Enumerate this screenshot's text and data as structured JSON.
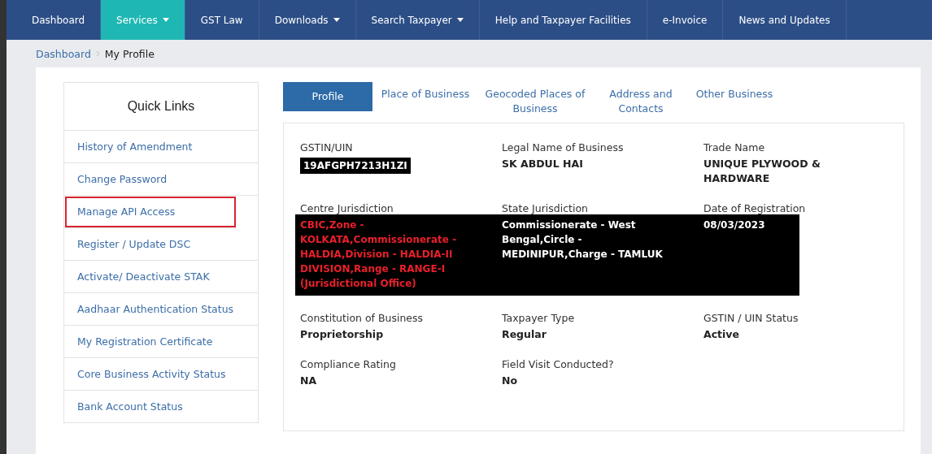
{
  "nav": [
    {
      "label": "Dashboard",
      "selected": false,
      "dropdown": false
    },
    {
      "label": "Services",
      "selected": true,
      "dropdown": true
    },
    {
      "label": "GST Law",
      "selected": false,
      "dropdown": false
    },
    {
      "label": "Downloads",
      "selected": false,
      "dropdown": true
    },
    {
      "label": "Search Taxpayer",
      "selected": false,
      "dropdown": true
    },
    {
      "label": "Help and Taxpayer Facilities",
      "selected": false,
      "dropdown": false
    },
    {
      "label": "e-Invoice",
      "selected": false,
      "dropdown": false
    },
    {
      "label": "News and Updates",
      "selected": false,
      "dropdown": false
    }
  ],
  "breadcrumb": [
    "Dashboard",
    "My Profile"
  ],
  "quick_links": {
    "title": "Quick Links",
    "items": [
      {
        "label": "History of Amendment",
        "highlighted": false
      },
      {
        "label": "Change Password",
        "highlighted": false
      },
      {
        "label": "Manage API Access",
        "highlighted": true
      },
      {
        "label": "Register / Update DSC",
        "highlighted": false
      },
      {
        "label": "Activate/ Deactivate STAK",
        "highlighted": false
      },
      {
        "label": "Aadhaar Authentication Status",
        "highlighted": false
      },
      {
        "label": "My Registration Certificate",
        "highlighted": false
      },
      {
        "label": "Core Business Activity Status",
        "highlighted": false
      },
      {
        "label": "Bank Account Status",
        "highlighted": false
      }
    ]
  },
  "tabs": [
    {
      "label": "Profile",
      "selected": true
    },
    {
      "label": "Place of Business",
      "selected": false
    },
    {
      "label": "Geocoded Places of Business",
      "selected": false
    },
    {
      "label": "Address and Contacts",
      "selected": false
    },
    {
      "label": "Other Business",
      "selected": false
    }
  ],
  "gstin": {
    "label": "GSTIN/UIN",
    "value": "19AFGPH7213H1ZI"
  },
  "rows": [
    [
      {
        "label": "Legal Name of Business",
        "value": "SK ABDUL HAI"
      },
      {
        "label": "Trade Name",
        "value": "UNIQUE PLYWOOD & HARDWARE"
      }
    ],
    [
      {
        "label": "Constitution of Business",
        "value": "Proprietorship"
      },
      {
        "label": "Taxpayer Type",
        "value": "Regular"
      },
      {
        "label": "GSTIN / UIN Status",
        "value": "Active"
      }
    ],
    [
      {
        "label": "Compliance Rating",
        "value": "NA"
      },
      {
        "label": "Field Visit Conducted?",
        "value": "No"
      }
    ]
  ],
  "jurisdiction": [
    {
      "label": "Centre Jurisdiction",
      "value": "CBIC,Zone - KOLKATA,Commissionerate - HALDIA,Division - HALDIA-II DIVISION,Range - RANGE-I (Jurisdictional Office)",
      "color": "#e8202a"
    },
    {
      "label": "State Jurisdiction",
      "value": "Commissionerate - West Bengal,Circle - MEDINIPUR,Charge - TAMLUK",
      "color": "#ffffff"
    },
    {
      "label": "Date of Registration",
      "value": "08/03/2023",
      "color": "#ffffff"
    }
  ]
}
